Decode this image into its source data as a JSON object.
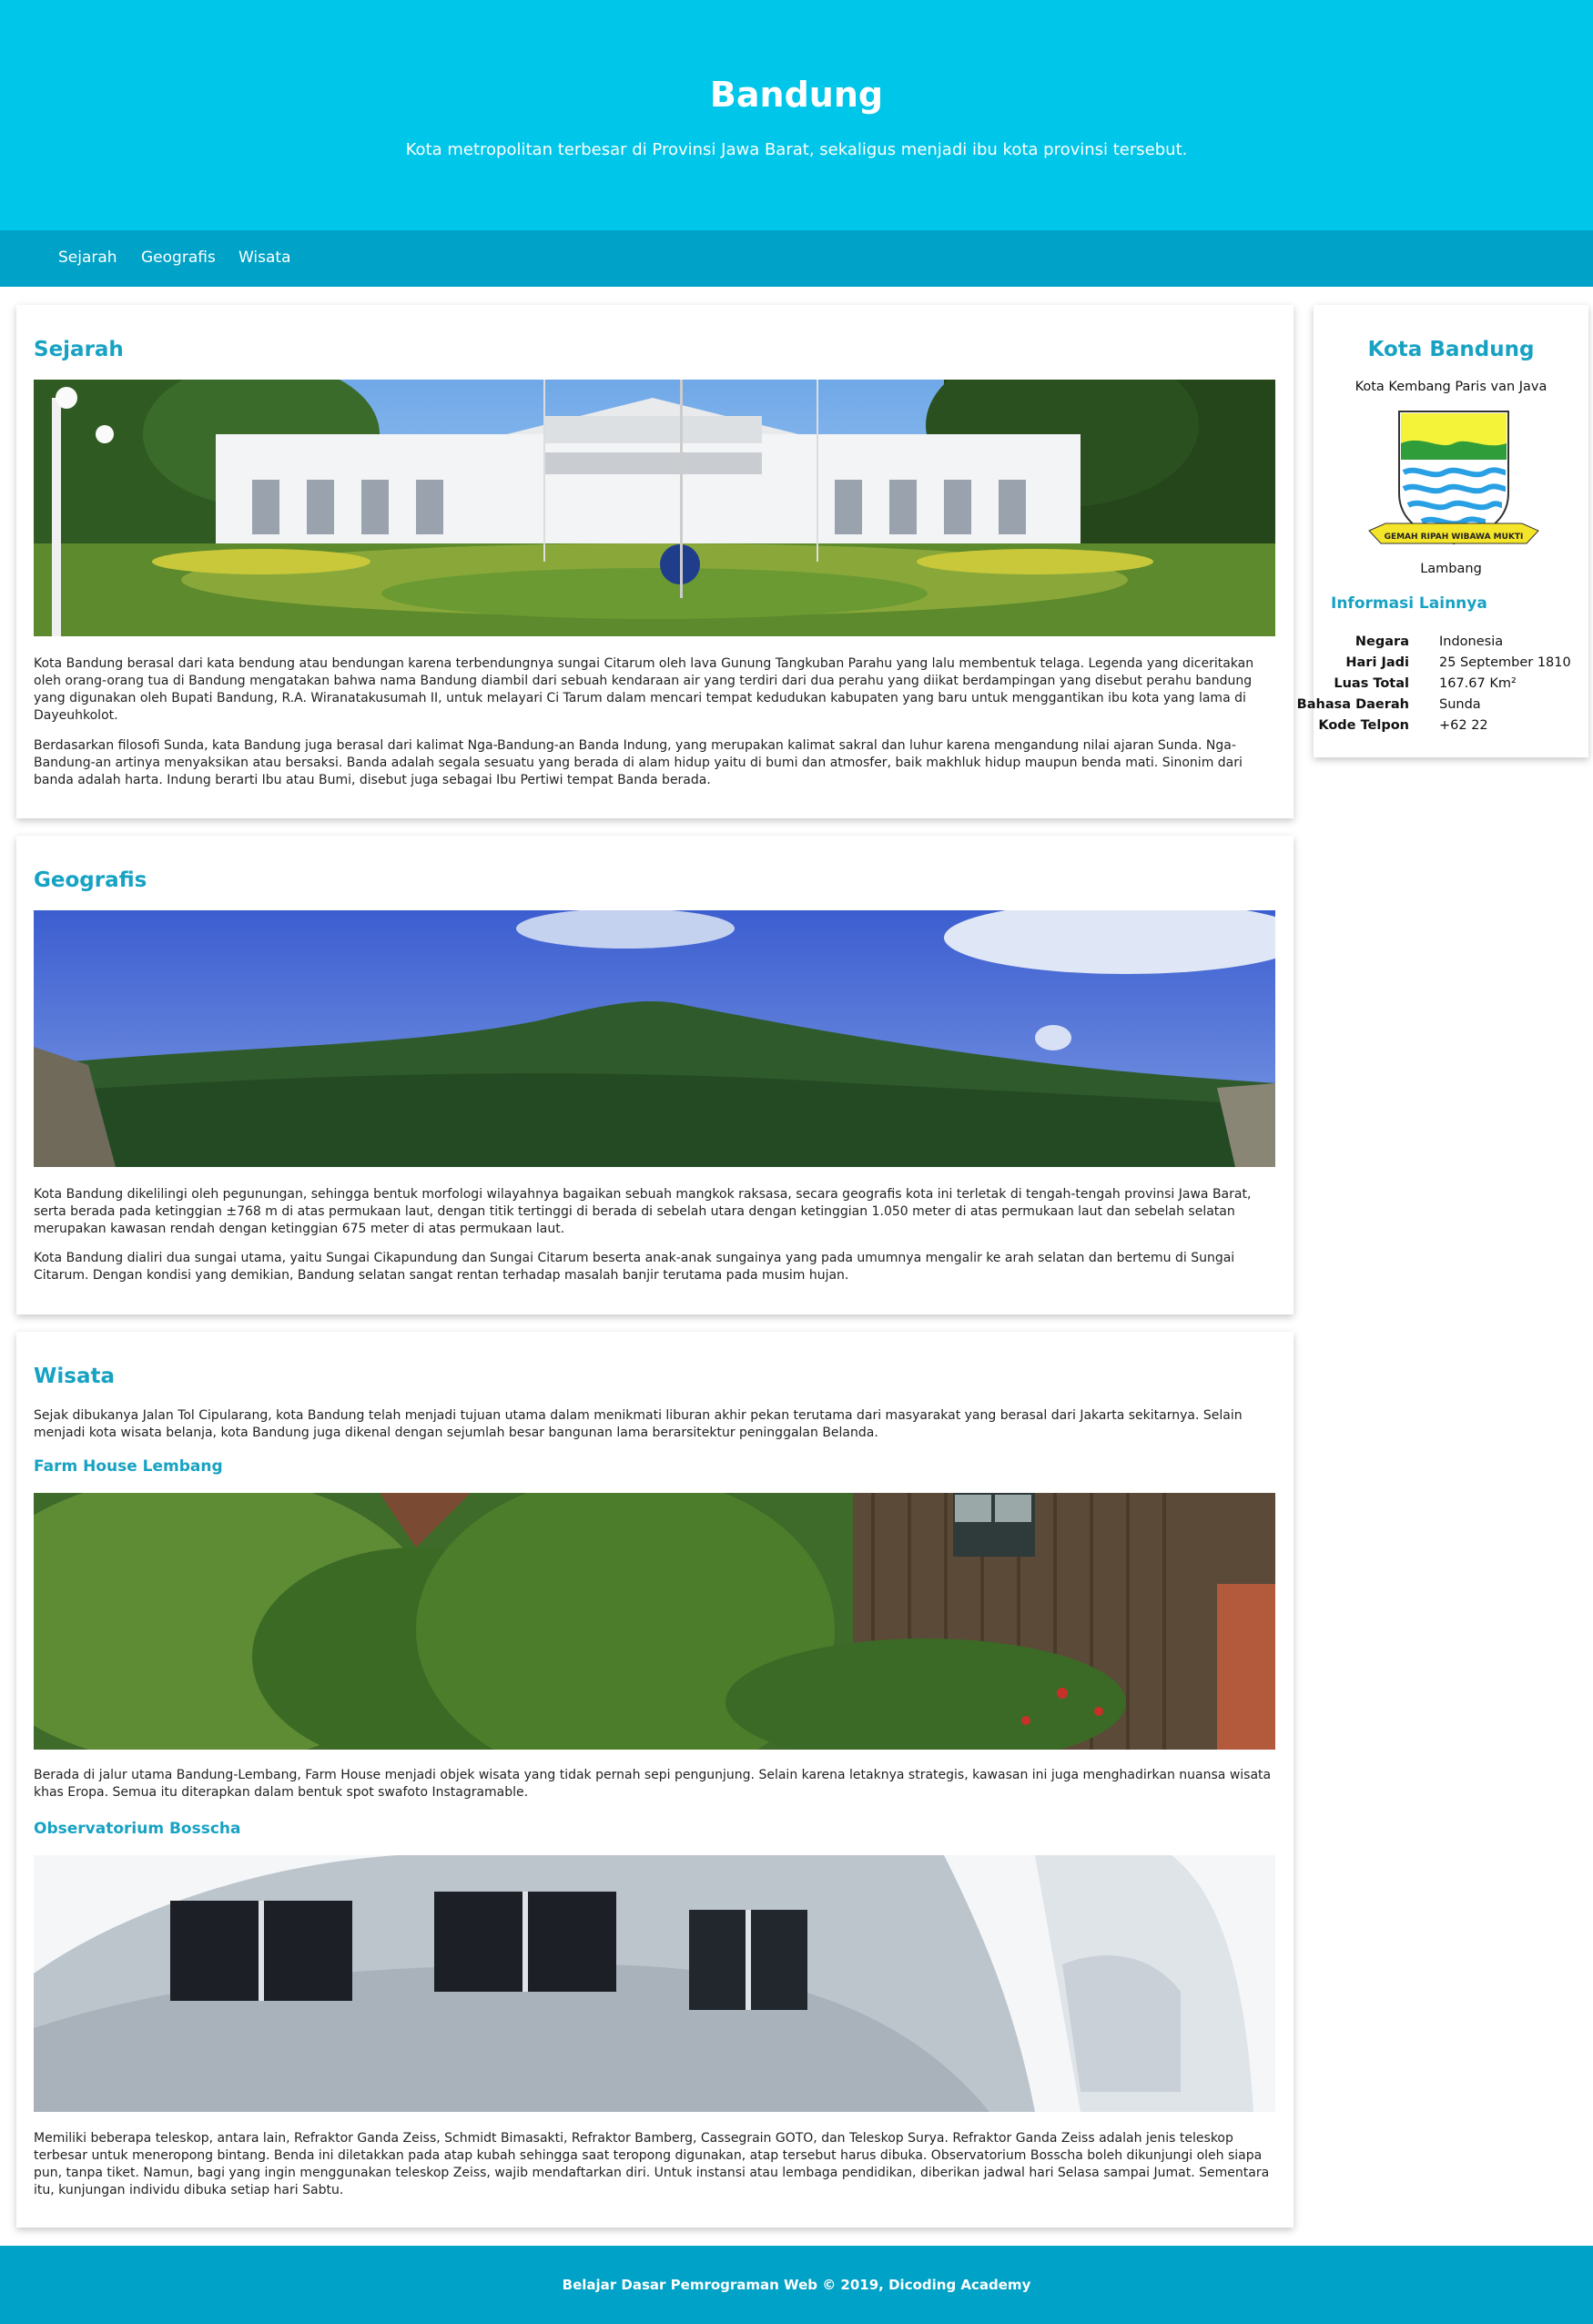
{
  "header": {
    "title": "Bandung",
    "subtitle": "Kota metropolitan terbesar di Provinsi Jawa Barat, sekaligus menjadi ibu kota provinsi tersebut."
  },
  "nav": {
    "items": [
      "Sejarah",
      "Geografis",
      "Wisata"
    ]
  },
  "sejarah": {
    "title": "Sejarah",
    "p1": "Kota Bandung berasal dari kata bendung atau bendungan karena terbendungnya sungai Citarum oleh lava Gunung Tangkuban Parahu yang lalu membentuk telaga. Legenda yang diceritakan oleh orang-orang tua di Bandung mengatakan bahwa nama Bandung diambil dari sebuah kendaraan air yang terdiri dari dua perahu yang diikat berdampingan yang disebut perahu bandung yang digunakan oleh Bupati Bandung, R.A. Wiranatakusumah II, untuk melayari Ci Tarum dalam mencari tempat kedudukan kabupaten yang baru untuk menggantikan ibu kota yang lama di Dayeuhkolot.",
    "p2": "Berdasarkan filosofi Sunda, kata Bandung juga berasal dari kalimat Nga-Bandung-an Banda Indung, yang merupakan kalimat sakral dan luhur karena mengandung nilai ajaran Sunda. Nga-Bandung-an artinya menyaksikan atau bersaksi. Banda adalah segala sesuatu yang berada di alam hidup yaitu di bumi dan atmosfer, baik makhluk hidup maupun benda mati. Sinonim dari banda adalah harta. Indung berarti Ibu atau Bumi, disebut juga sebagai Ibu Pertiwi tempat Banda berada."
  },
  "geografis": {
    "title": "Geografis",
    "p1": "Kota Bandung dikelilingi oleh pegunungan, sehingga bentuk morfologi wilayahnya bagaikan sebuah mangkok raksasa, secara geografis kota ini terletak di tengah-tengah provinsi Jawa Barat, serta berada pada ketinggian ±768 m di atas permukaan laut, dengan titik tertinggi di berada di sebelah utara dengan ketinggian 1.050 meter di atas permukaan laut dan sebelah selatan merupakan kawasan rendah dengan ketinggian 675 meter di atas permukaan laut.",
    "p2": "Kota Bandung dialiri dua sungai utama, yaitu Sungai Cikapundung dan Sungai Citarum beserta anak-anak sungainya yang pada umumnya mengalir ke arah selatan dan bertemu di Sungai Citarum. Dengan kondisi yang demikian, Bandung selatan sangat rentan terhadap masalah banjir terutama pada musim hujan."
  },
  "wisata": {
    "title": "Wisata",
    "intro": "Sejak dibukanya Jalan Tol Cipularang, kota Bandung telah menjadi tujuan utama dalam menikmati liburan akhir pekan terutama dari masyarakat yang berasal dari Jakarta sekitarnya. Selain menjadi kota wisata belanja, kota Bandung juga dikenal dengan sejumlah besar bangunan lama berarsitektur peninggalan Belanda.",
    "farm_title": "Farm House Lembang",
    "farm_text": "Berada di jalur utama Bandung-Lembang, Farm House menjadi objek wisata yang tidak pernah sepi pengunjung. Selain karena letaknya strategis, kawasan ini juga menghadirkan nuansa wisata khas Eropa. Semua itu diterapkan dalam bentuk spot swafoto Instagramable.",
    "bosscha_title": "Observatorium Bosscha",
    "bosscha_text": "Memiliki beberapa teleskop, antara lain, Refraktor Ganda Zeiss, Schmidt Bimasakti, Refraktor Bamberg, Cassegrain GOTO, dan Teleskop Surya. Refraktor Ganda Zeiss adalah jenis teleskop terbesar untuk meneropong bintang. Benda ini diletakkan pada atap kubah sehingga saat teropong digunakan, atap tersebut harus dibuka. Observatorium Bosscha boleh dikunjungi oleh siapa pun, tanpa tiket. Namun, bagi yang ingin menggunakan teleskop Zeiss, wajib mendaftarkan diri. Untuk instansi atau lembaga pendidikan, diberikan jadwal hari Selasa sampai Jumat. Sementara itu, kunjungan individu dibuka setiap hari Sabtu."
  },
  "aside": {
    "title": "Kota Bandung",
    "subtitle": "Kota Kembang Paris van Java",
    "emblem_motto": "GEMAH RIPAH WIBAWA MUKTI",
    "emblem_caption": "Lambang",
    "info_title": "Informasi Lainnya",
    "info": [
      {
        "key": "Negara",
        "value": "Indonesia"
      },
      {
        "key": "Hari Jadi",
        "value": "25 September 1810"
      },
      {
        "key": "Luas Total",
        "value": "167.67 Km²"
      },
      {
        "key": "Bahasa Daerah",
        "value": "Sunda"
      },
      {
        "key": "Kode Telpon",
        "value": "+62 22"
      }
    ]
  },
  "footer": {
    "text": "Belajar Dasar Pemrograman Web © 2019, Dicoding Academy"
  },
  "colors": {
    "header_bg": "#00c6e9",
    "nav_bg": "#00a2c7",
    "accent": "#17a2c4"
  }
}
